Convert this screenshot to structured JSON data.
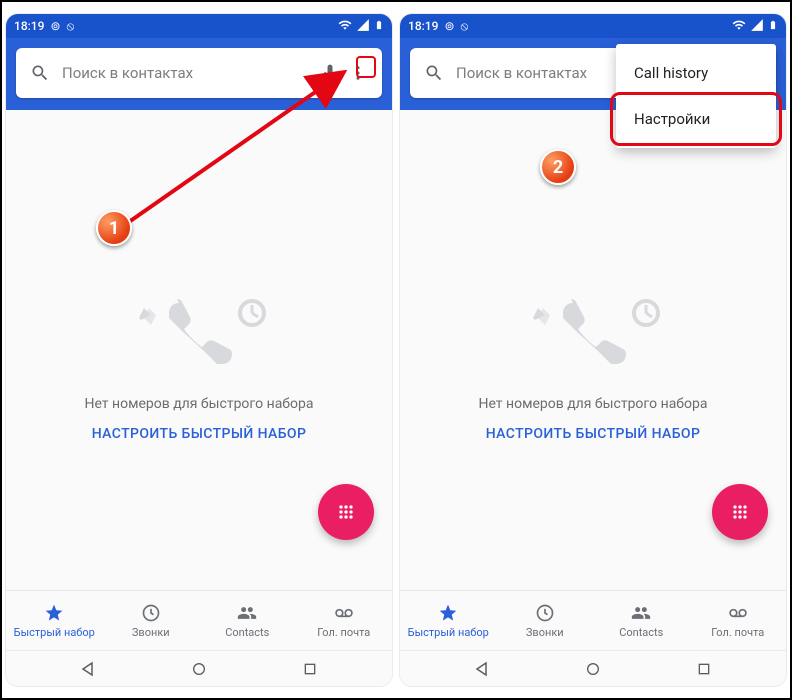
{
  "statusbar": {
    "time": "18:19",
    "icons_left": [
      "rc-icon",
      "ds-icon"
    ],
    "icons_right": [
      "wifi-icon",
      "signal-icon",
      "battery-icon"
    ]
  },
  "search": {
    "placeholder": "Поиск в контактах"
  },
  "empty": {
    "message": "Нет номеров для быстрого набора",
    "cta": "НАСТРОИТЬ БЫСТРЫЙ НАБОР"
  },
  "tabs": [
    {
      "label": "Быстрый набор",
      "icon": "star-icon",
      "active": true
    },
    {
      "label": "Звонки",
      "icon": "clock-icon",
      "active": false
    },
    {
      "label": "Contacts",
      "icon": "people-icon",
      "active": false
    },
    {
      "label": "Гол. почта",
      "icon": "voicemail-icon",
      "active": false
    }
  ],
  "popup": {
    "items": [
      "Call history",
      "Настройки"
    ],
    "highlight_index": 1
  },
  "annotations": {
    "badge1": "1",
    "badge2": "2"
  }
}
